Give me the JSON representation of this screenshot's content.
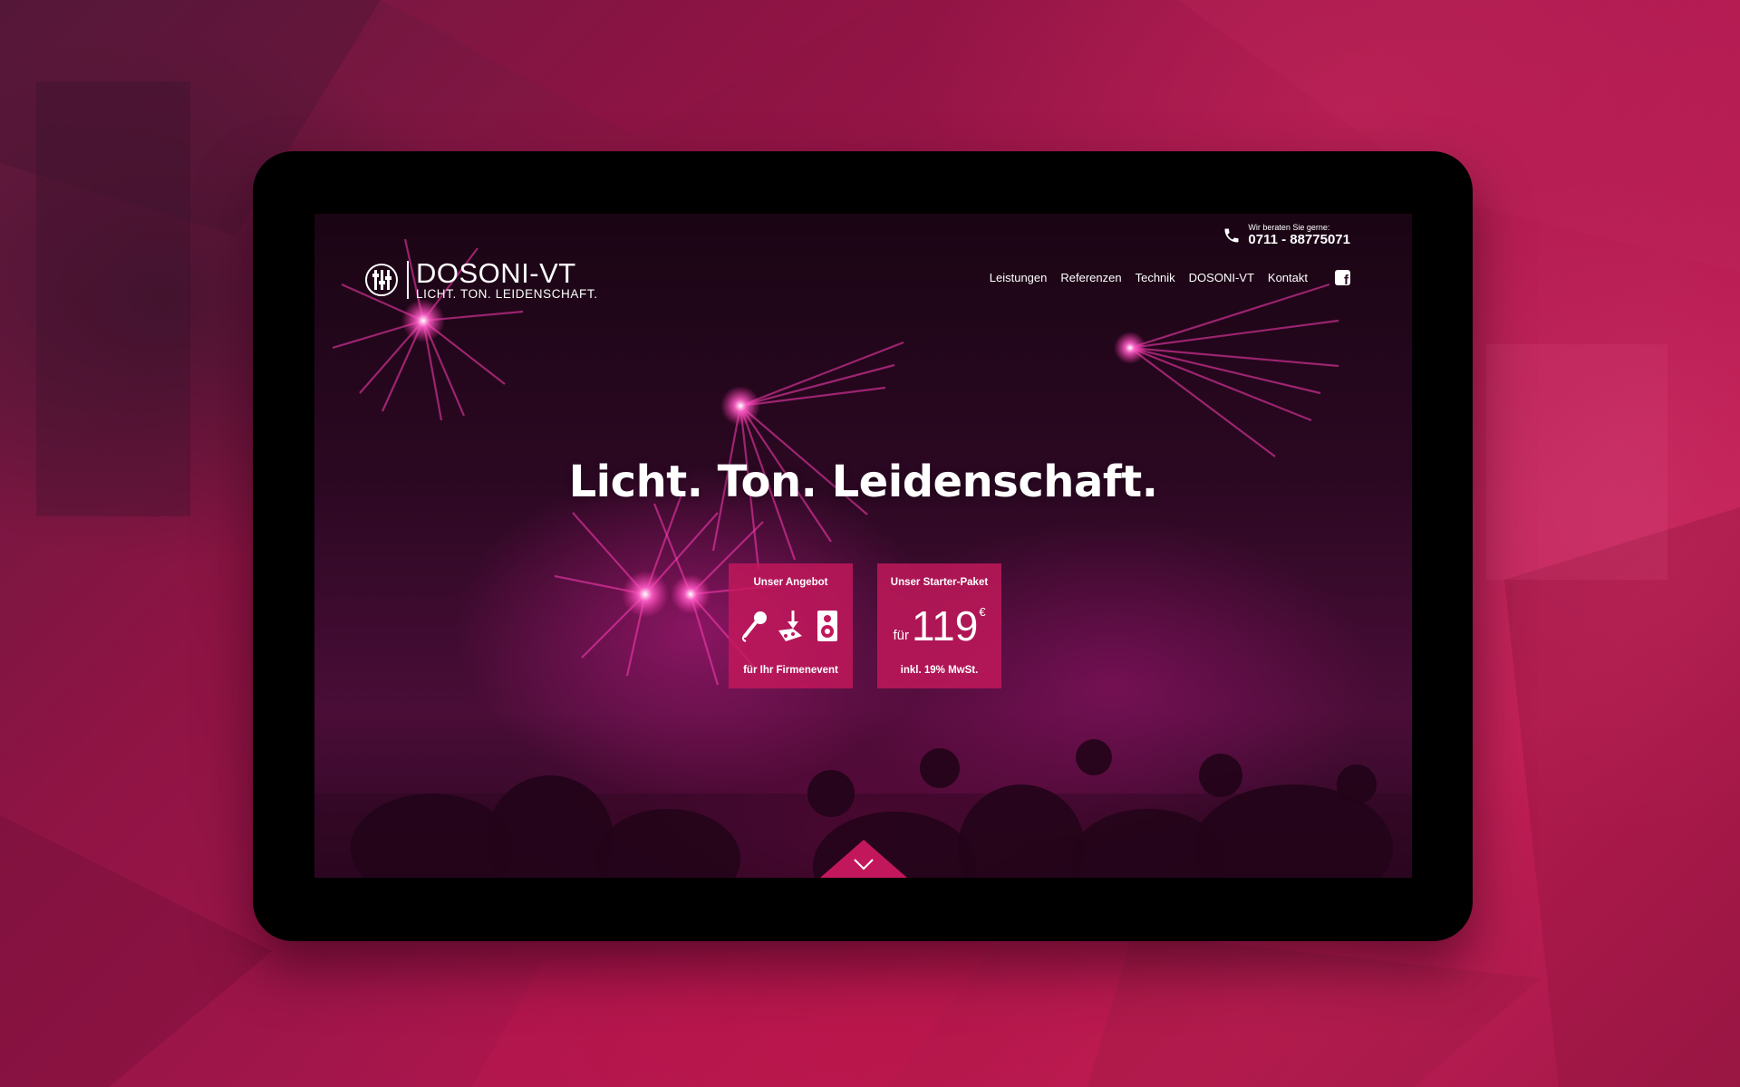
{
  "site": {
    "brand": {
      "name": "DOSONI-VT",
      "tagline": "LICHT. TON. LEIDENSCHAFT.",
      "logo_icon": "mixer-faders-icon"
    },
    "contact": {
      "label": "Wir beraten Sie gerne:",
      "phone": "0711 - 88775071",
      "icon": "phone-icon"
    },
    "nav": {
      "items": [
        {
          "label": "Leistungen"
        },
        {
          "label": "Referenzen"
        },
        {
          "label": "Technik"
        },
        {
          "label": "DOSONI-VT"
        },
        {
          "label": "Kontakt"
        }
      ],
      "social_icon": "facebook-icon"
    },
    "hero": {
      "headline": "Licht. Ton. Leidenschaft."
    },
    "cards": {
      "offer": {
        "title": "Unser Angebot",
        "icons": [
          "microphone-icon",
          "mixer-download-icon",
          "speaker-icon"
        ],
        "footer": "für Ihr Firmenevent"
      },
      "starter": {
        "title": "Unser Starter-Paket",
        "price_prefix": "für",
        "price_value": "119",
        "price_currency": "€",
        "footer": "inkl. 19% MwSt."
      }
    },
    "scroll_icon": "chevron-down-icon"
  },
  "colors": {
    "accent": "#c2185b",
    "background": "#8d1240",
    "frame": "#000000"
  }
}
